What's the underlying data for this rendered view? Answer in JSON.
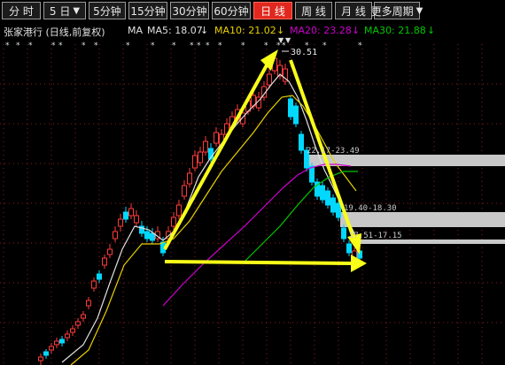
{
  "tabs": [
    {
      "label": "分 时",
      "active": false,
      "dropdown": false
    },
    {
      "label": "5 日",
      "active": false,
      "dropdown": true
    },
    {
      "label": "5分钟",
      "active": false,
      "dropdown": false
    },
    {
      "label": "15分钟",
      "active": false,
      "dropdown": false
    },
    {
      "label": "30分钟",
      "active": false,
      "dropdown": false
    },
    {
      "label": "60分钟",
      "active": false,
      "dropdown": false
    },
    {
      "label": "日 线",
      "active": true,
      "dropdown": false
    },
    {
      "label": "周 线",
      "active": false,
      "dropdown": false
    },
    {
      "label": "月 线",
      "active": false,
      "dropdown": false
    },
    {
      "label": "更多周期",
      "active": false,
      "dropdown": true
    }
  ],
  "legend": {
    "stock_title": "张家港行 (日线,前复权)",
    "ma_label": "MA",
    "ma5": "MA5: 18.07",
    "ma5_arrow": "↓",
    "ma10": "MA10: 21.02",
    "ma10_arrow": "↓",
    "ma20": "MA20: 23.28",
    "ma20_arrow": "↓",
    "ma30": "MA30: 21.88",
    "ma30_arrow": "↓"
  },
  "colors": {
    "ma5": "#e0e0e0",
    "ma10": "#e8d000",
    "ma20": "#d000d0",
    "ma30": "#00c800",
    "up_candle": "#ff3c3c",
    "down_candle": "#00d8ff",
    "annotation_arrow": "#f8ff18",
    "gap_band": "#c8c8c8",
    "grid": "#c82828"
  },
  "annotations": {
    "peak_price": "30.51",
    "band1_label": "22.17-23.49",
    "band2_label": "19.40-18.30",
    "band3_label": "17.51-17.15"
  },
  "chart_data": {
    "type": "candlestick",
    "peak_high": 30.51,
    "ma_last": {
      "MA5": 18.07,
      "MA10": 21.02,
      "MA20": 23.28,
      "MA30": 21.88
    },
    "gap_zones": [
      [
        22.17,
        23.49
      ],
      [
        18.3,
        19.4
      ],
      [
        17.15,
        17.51
      ]
    ],
    "trend_arrows": [
      "up",
      "down",
      "right"
    ]
  }
}
